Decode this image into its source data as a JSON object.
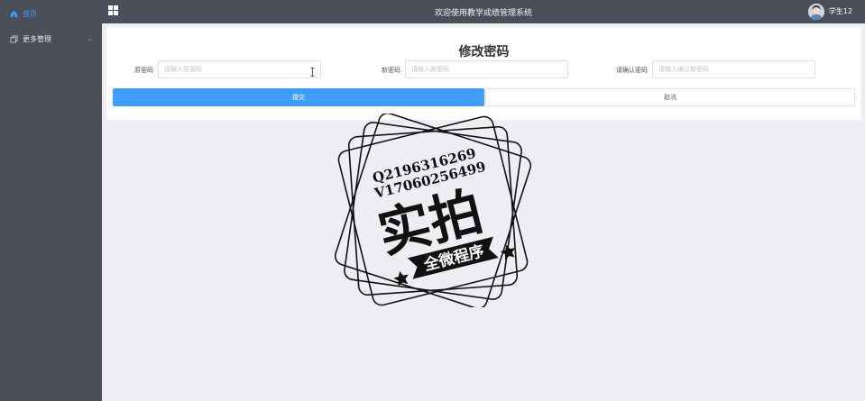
{
  "sidebar": {
    "items": [
      {
        "label": "首页",
        "icon": "home-icon",
        "active": true
      },
      {
        "label": "更多管理",
        "icon": "copy-icon"
      }
    ]
  },
  "header": {
    "title": "欢迎使用教学成绩管理系统",
    "user_name": "学生12",
    "menu_icon": "grid-icon"
  },
  "form": {
    "title": "修改密码",
    "fields": [
      {
        "label": "原密码",
        "placeholder": "请输入原密码",
        "value": ""
      },
      {
        "label": "新密码",
        "placeholder": "请输入新密码",
        "value": ""
      },
      {
        "label": "请确认密码",
        "placeholder": "请输入确认新密码",
        "value": ""
      }
    ],
    "submit_label": "提交",
    "cancel_label": "取消"
  },
  "watermark": {
    "line1": "Q2196316269",
    "line2": "V17060256499",
    "main": "实拍",
    "ribbon": "全微程序"
  },
  "colors": {
    "primary": "#409eff",
    "sidebar_bg": "#4a4f5a",
    "page_bg": "#eeeef2"
  }
}
